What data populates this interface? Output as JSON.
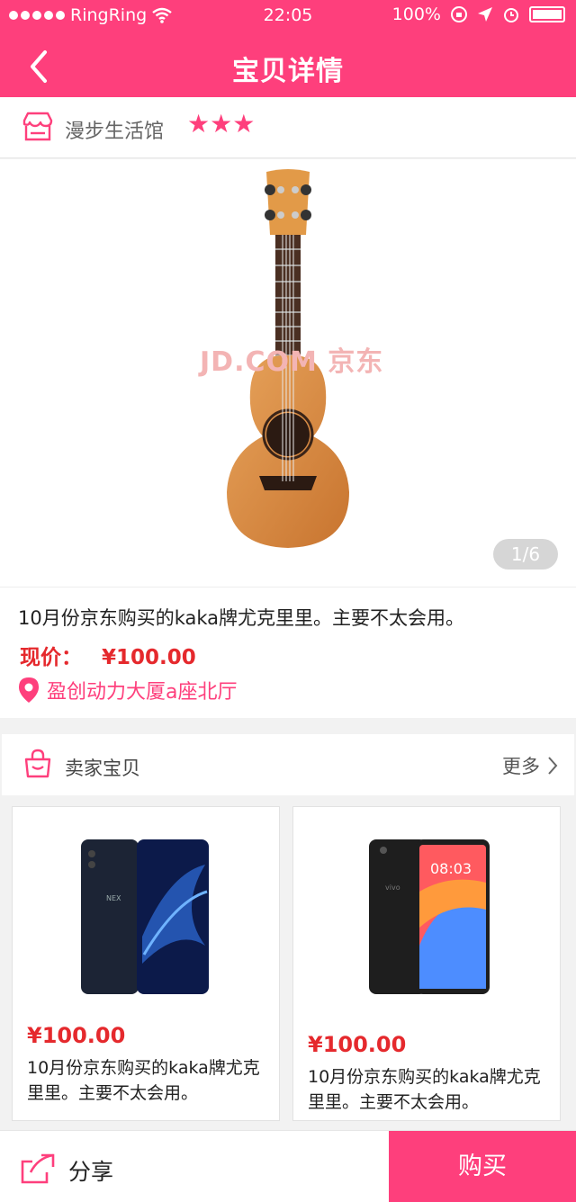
{
  "status_bar": {
    "carrier": "RingRing",
    "time": "22:05",
    "battery": "100%"
  },
  "nav": {
    "title": "宝贝详情"
  },
  "shop": {
    "name": "漫步生活馆",
    "stars": "★★★"
  },
  "gallery": {
    "watermark": "JD.COM 京东",
    "pager": "1/6"
  },
  "item": {
    "description": "10月份京东购买的kaka牌尤克里里。主要不太会用。",
    "price_label": "现价：",
    "price": "¥100.00",
    "location": "盈创动力大厦a座北厅"
  },
  "seller": {
    "title": "卖家宝贝",
    "more": "更多",
    "products": [
      {
        "price": "¥100.00",
        "text": "10月份京东购买的kaka牌尤克里里。主要不太会用。"
      },
      {
        "price": "¥100.00",
        "text": "10月份京东购买的kaka牌尤克里里。主要不太会用。"
      }
    ]
  },
  "bottom": {
    "share": "分享",
    "buy": "购买"
  },
  "colors": {
    "brand": "#fe3f7c",
    "price": "#e5292d"
  }
}
